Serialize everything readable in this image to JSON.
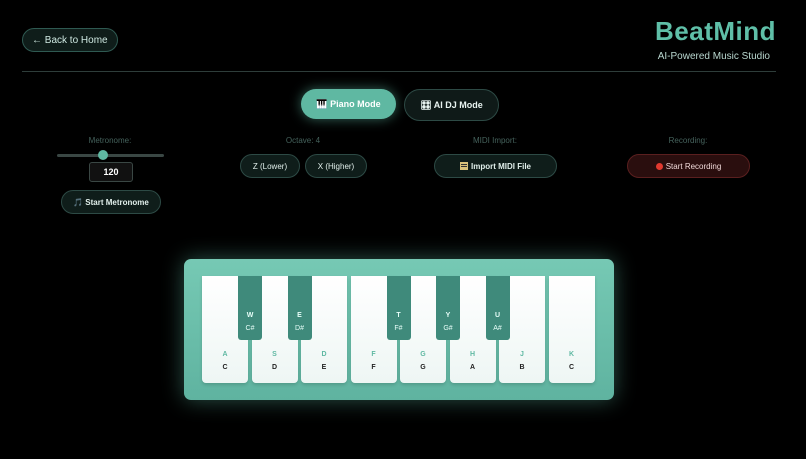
{
  "header": {
    "back_label": "← Back to Home",
    "brand_title": "BeatMind",
    "brand_subtitle": "AI-Powered Music Studio"
  },
  "modes": {
    "piano_label": "🎹 Piano Mode",
    "dj_label": "🎛 AI DJ Mode",
    "active": "piano"
  },
  "metronome": {
    "label": "Metronome:",
    "tempo": "120",
    "slider_fraction": 0.43,
    "start_label": "🎵 Start Metronome"
  },
  "octave": {
    "label": "Octave: 4",
    "lower_label": "Z (Lower)",
    "higher_label": "X (Higher)"
  },
  "midi": {
    "label": "MIDI Import:",
    "import_label": "Import MIDI File"
  },
  "recording": {
    "label": "Recording:",
    "start_label": "Start Recording"
  },
  "piano": {
    "white_keys": [
      {
        "key": "A",
        "note": "C"
      },
      {
        "key": "S",
        "note": "D"
      },
      {
        "key": "D",
        "note": "E"
      },
      {
        "key": "F",
        "note": "F"
      },
      {
        "key": "G",
        "note": "G"
      },
      {
        "key": "H",
        "note": "A"
      },
      {
        "key": "J",
        "note": "B"
      },
      {
        "key": "K",
        "note": "C"
      }
    ],
    "black_keys": [
      {
        "key": "W",
        "note": "C#"
      },
      {
        "key": "E",
        "note": "D#"
      },
      {
        "key": "T",
        "note": "F#"
      },
      {
        "key": "Y",
        "note": "G#"
      },
      {
        "key": "U",
        "note": "A#"
      }
    ]
  },
  "colors": {
    "accent": "#5fb8a2",
    "record": "#e0392f"
  }
}
